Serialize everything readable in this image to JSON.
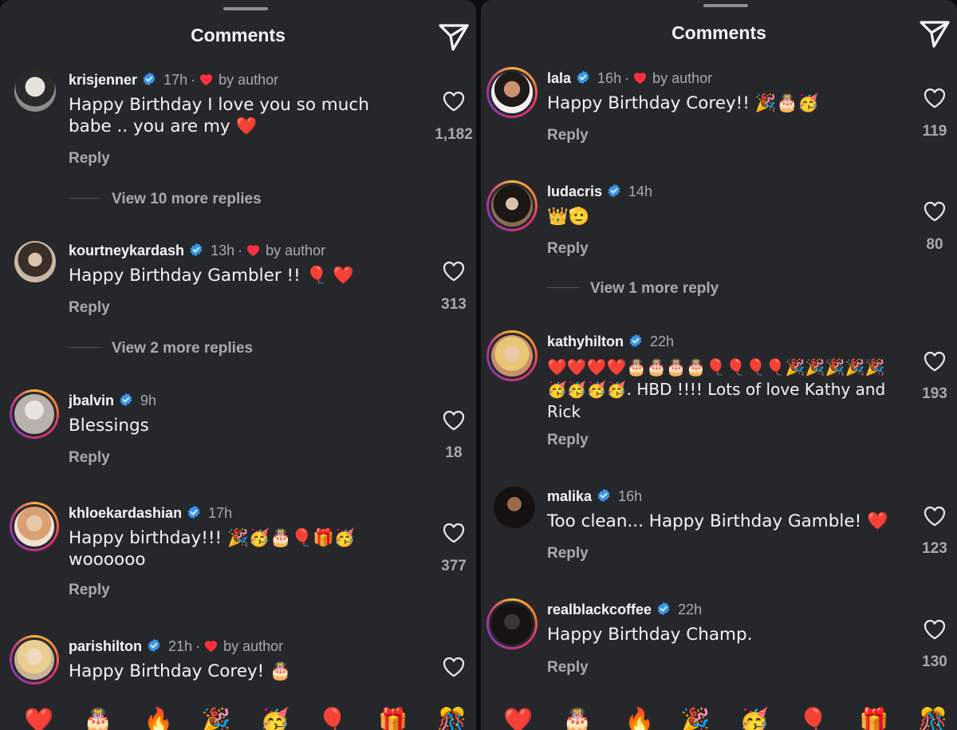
{
  "left_panel": {
    "title": "Comments",
    "comments": [
      {
        "user": "krisjenner",
        "time": "17h",
        "by_author": "by author",
        "text": "Happy Birthday I love you so much babe .. you are my ❤️",
        "reply": "Reply",
        "likes": "1,182",
        "more": "View 10 more replies"
      },
      {
        "user": "kourtneykardash",
        "time": "13h",
        "by_author": "by author",
        "text": "Happy Birthday Gambler !! 🎈 ❤️",
        "reply": "Reply",
        "likes": "313",
        "more": "View 2 more replies"
      },
      {
        "user": "jbalvin",
        "time": "9h",
        "text": "Blessings",
        "reply": "Reply",
        "likes": "18"
      },
      {
        "user": "khloekardashian",
        "time": "17h",
        "text": "Happy birthday!!! 🎉🥳🎂🎈🎁🥳 woooooo",
        "reply": "Reply",
        "likes": "377"
      },
      {
        "user": "parishilton",
        "time": "21h",
        "by_author": "by author",
        "text": "Happy Birthday Corey! 🎂"
      }
    ],
    "emoji_bar": [
      "❤️",
      "🎂",
      "🔥",
      "🎉",
      "🥳",
      "🎈",
      "🎁",
      "🎊"
    ]
  },
  "right_panel": {
    "title": "Comments",
    "comments": [
      {
        "user": "lala",
        "time": "16h",
        "by_author": "by author",
        "text": "Happy Birthday Corey!! 🎉🎂🥳",
        "reply": "Reply",
        "likes": "119"
      },
      {
        "user": "ludacris",
        "time": "14h",
        "text": "👑🫡",
        "reply": "Reply",
        "likes": "80",
        "more": "View 1 more reply"
      },
      {
        "user": "kathyhilton",
        "time": "22h",
        "text": "❤️❤️❤️❤️🎂🎂🎂🎂🎈🎈🎈🎈🎉🎉🎉🎉🎉🥳🥳🥳🥳. HBD !!!! Lots of love Kathy and Rick",
        "reply": "Reply",
        "likes": "193"
      },
      {
        "user": "malika",
        "time": "16h",
        "text": "Too clean... Happy Birthday Gamble! ❤️",
        "reply": "Reply",
        "likes": "123"
      },
      {
        "user": "realblackcoffee",
        "time": "22h",
        "text": "Happy Birthday Champ.",
        "reply": "Reply",
        "likes": "130"
      }
    ],
    "emoji_bar": [
      "❤️",
      "🎂",
      "🔥",
      "🎉",
      "🥳",
      "🎈",
      "🎁",
      "🎊"
    ]
  },
  "colors": {
    "verified": "#3897f0",
    "heart": "#ff3040",
    "muted": "#a8aaaf",
    "panel": "#26272b"
  }
}
